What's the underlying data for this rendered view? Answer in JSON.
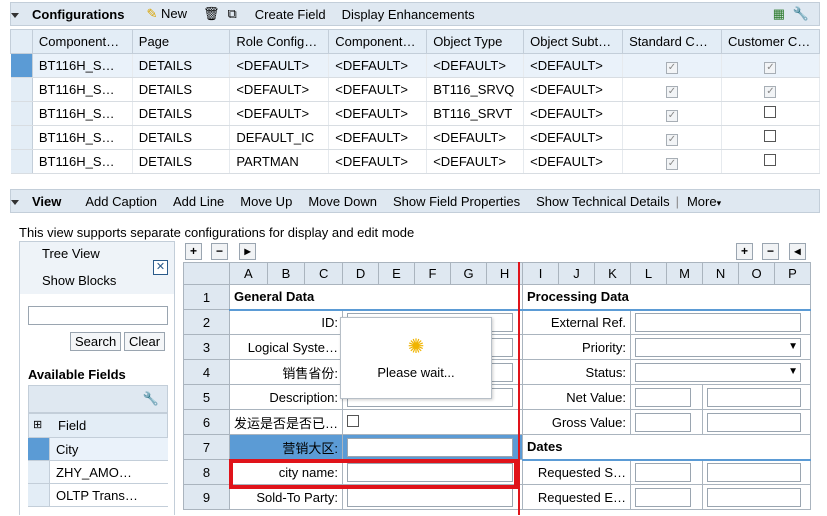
{
  "config_panel": {
    "title": "Configurations",
    "new_label": "New",
    "create_field_label": "Create Field",
    "display_enhancements_label": "Display Enhancements"
  },
  "config_table": {
    "headers": [
      "Component…",
      "Page",
      "Role Config…",
      "Component…",
      "Object Type",
      "Object Subt…",
      "Standard C…",
      "Customer C…"
    ],
    "rows": [
      {
        "c0": "BT116H_S…",
        "c1": "DETAILS",
        "c2": "<DEFAULT>",
        "c3": "<DEFAULT>",
        "c4": "<DEFAULT>",
        "c5": "<DEFAULT>",
        "std": true,
        "cust": true
      },
      {
        "c0": "BT116H_S…",
        "c1": "DETAILS",
        "c2": "<DEFAULT>",
        "c3": "<DEFAULT>",
        "c4": "BT116_SRVQ",
        "c5": "<DEFAULT>",
        "std": true,
        "cust": true
      },
      {
        "c0": "BT116H_S…",
        "c1": "DETAILS",
        "c2": "<DEFAULT>",
        "c3": "<DEFAULT>",
        "c4": "BT116_SRVT",
        "c5": "<DEFAULT>",
        "std": true,
        "cust": false
      },
      {
        "c0": "BT116H_S…",
        "c1": "DETAILS",
        "c2": "DEFAULT_IC",
        "c3": "<DEFAULT>",
        "c4": "<DEFAULT>",
        "c5": "<DEFAULT>",
        "std": true,
        "cust": false
      },
      {
        "c0": "BT116H_S…",
        "c1": "DETAILS",
        "c2": "PARTMAN",
        "c3": "<DEFAULT>",
        "c4": "<DEFAULT>",
        "c5": "<DEFAULT>",
        "std": true,
        "cust": false
      }
    ]
  },
  "view_panel": {
    "title": "View",
    "buttons": [
      "Add Caption",
      "Add Line",
      "Move Up",
      "Move Down",
      "Show Field Properties",
      "Show Technical Details"
    ],
    "more_label": "More",
    "note": "This view supports separate configurations for display and edit mode"
  },
  "side": {
    "tree_view": "Tree View",
    "show_blocks": "Show Blocks",
    "search_label": "Search",
    "clear_label": "Clear",
    "available_fields": "Available Fields",
    "field_header": "Field",
    "fields": [
      "City",
      "ZHY_AMO…",
      "OLTP Trans…"
    ]
  },
  "grid": {
    "left_cols": [
      "A",
      "B",
      "C",
      "D",
      "E",
      "F",
      "G",
      "H"
    ],
    "right_cols": [
      "I",
      "J",
      "K",
      "L",
      "M",
      "N",
      "O",
      "P"
    ],
    "rows": [
      "1",
      "2",
      "3",
      "4",
      "5",
      "6",
      "7",
      "8",
      "9"
    ],
    "general_data": "General Data",
    "processing_data": "Processing Data",
    "dates": "Dates",
    "left_labels": [
      "",
      "ID:",
      "Logical Syste…",
      "销售省份:",
      "Description:",
      "发运是否是否已…",
      "营销大区:",
      "city name:",
      "Sold-To Party:"
    ],
    "right_labels": [
      "",
      "External Ref.",
      "Priority:",
      "Status:",
      "Net Value:",
      "Gross Value:",
      "",
      "Requested S…",
      "Requested E…"
    ]
  },
  "wait_popup": {
    "text": "Please wait..."
  }
}
